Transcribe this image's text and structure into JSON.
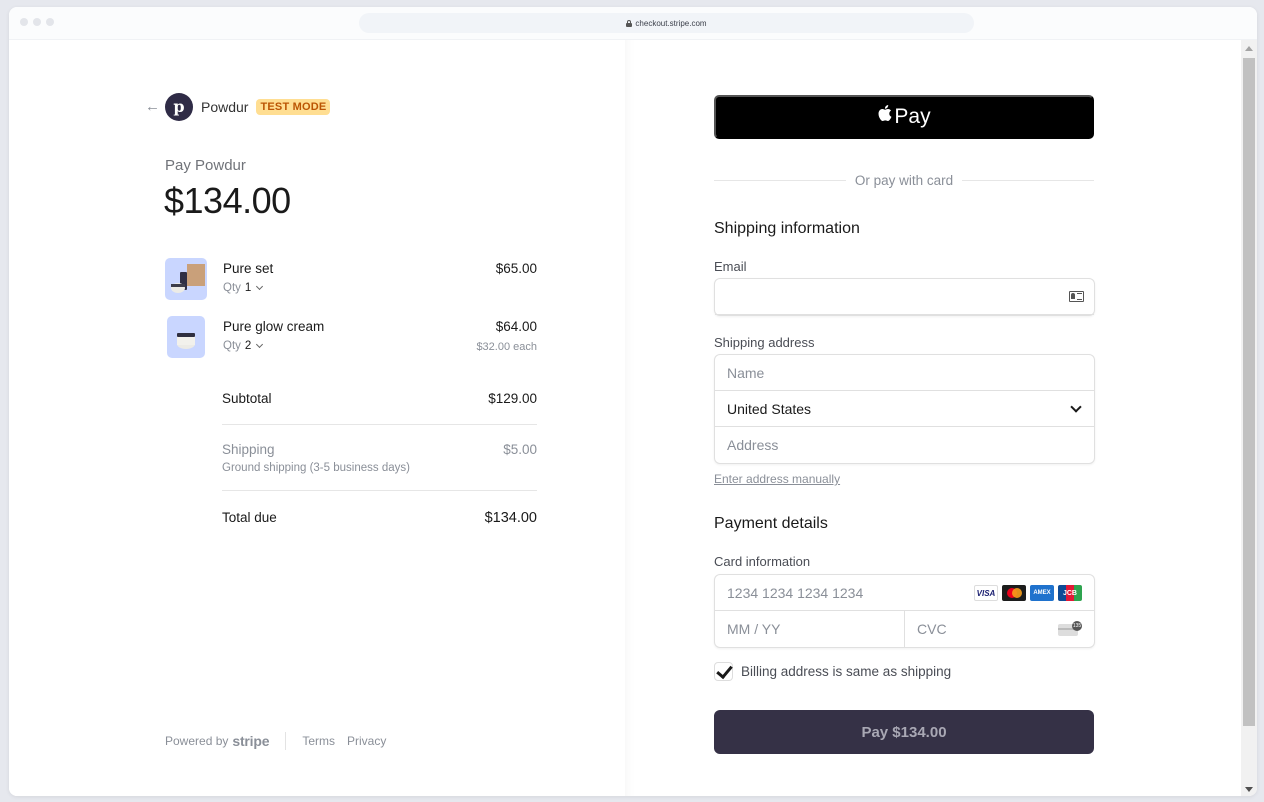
{
  "browser": {
    "url": "checkout.stripe.com"
  },
  "merchant": {
    "logo_letter": "p",
    "name": "Powdur",
    "badge": "TEST MODE",
    "pay_label": "Pay Powdur",
    "amount": "$134.00"
  },
  "items": [
    {
      "name": "Pure set",
      "qty_label": "Qty",
      "qty": "1",
      "price": "$65.00",
      "each": ""
    },
    {
      "name": "Pure glow cream",
      "qty_label": "Qty",
      "qty": "2",
      "price": "$64.00",
      "each": "$32.00 each"
    }
  ],
  "summary": {
    "subtotal_label": "Subtotal",
    "subtotal": "$129.00",
    "shipping_label": "Shipping",
    "shipping_desc": "Ground shipping (3-5 business days)",
    "shipping": "$5.00",
    "total_label": "Total due",
    "total": "$134.00"
  },
  "footer": {
    "powered_by": "Powered by",
    "stripe": "stripe",
    "terms": "Terms",
    "privacy": "Privacy"
  },
  "payment": {
    "apple_pay_glyph": "",
    "apple_pay_label": "Pay",
    "or_text": "Or pay with card",
    "shipping_title": "Shipping information",
    "email_label": "Email",
    "email_value": "",
    "shipping_address_label": "Shipping address",
    "name_placeholder": "Name",
    "country": "United States",
    "address_placeholder": "Address",
    "enter_manually": "Enter address manually",
    "payment_title": "Payment details",
    "card_label": "Card information",
    "card_placeholder": "1234 1234 1234 1234",
    "expiry_placeholder": "MM / YY",
    "cvc_placeholder": "CVC",
    "card_brands": [
      "VISA",
      "Mastercard",
      "AMEX",
      "JCB"
    ],
    "billing_same_label": "Billing address is same as shipping",
    "billing_same_checked": true,
    "pay_button": "Pay $134.00"
  },
  "colors": {
    "brand_dark": "#353146",
    "test_badge_bg": "#ffde92",
    "test_badge_text": "#bb5504",
    "product_thumb_bg": "#c9d6ff"
  }
}
